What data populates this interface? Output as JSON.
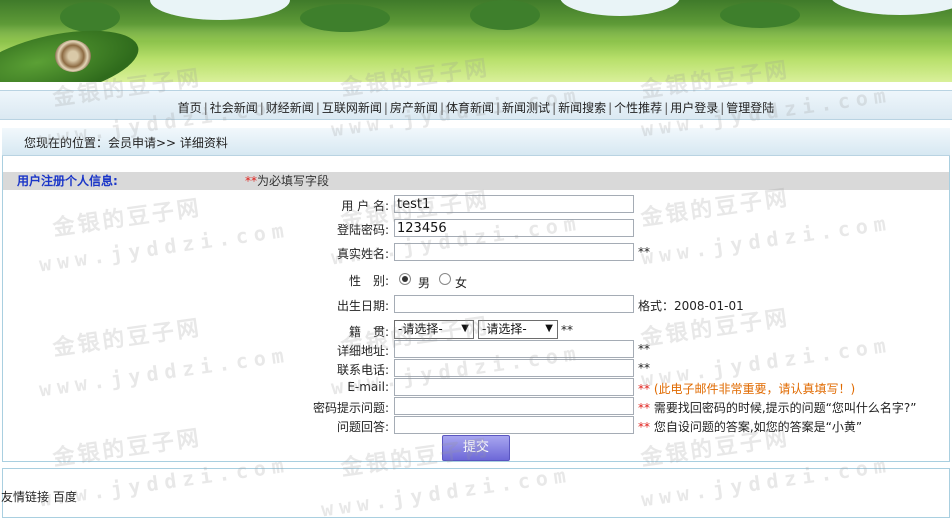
{
  "nav": {
    "items": [
      "首页",
      "社会新闻",
      "财经新闻",
      "互联网新闻",
      "房产新闻",
      "体育新闻",
      "新闻测试",
      "新闻搜索",
      "个性推荐",
      "用户登录",
      "管理登陆"
    ],
    "separator": "|"
  },
  "location": {
    "text": "您现在的位置：会员申请>> 详细资料"
  },
  "form_header": {
    "title": "用户注册个人信息:",
    "required_mark": "**",
    "required_text": "为必填写字段"
  },
  "fields": {
    "username": {
      "label": "用 户 名:",
      "value": "test1"
    },
    "password": {
      "label": "登陆密码:",
      "value": "123456"
    },
    "realname": {
      "label": "真实姓名:",
      "value": "",
      "mark": "**"
    },
    "gender": {
      "label": "性　别:",
      "options": [
        "男",
        "女"
      ],
      "selected": "男"
    },
    "birthday": {
      "label": "出生日期:",
      "value": "",
      "hint": "格式：2008-01-01"
    },
    "origin": {
      "label": "籍　贯:",
      "province": "-请选择-",
      "city": "-请选择-",
      "mark": "**"
    },
    "address": {
      "label": "详细地址:",
      "value": "",
      "mark": "**"
    },
    "phone": {
      "label": "联系电话:",
      "value": "",
      "mark": "**"
    },
    "email": {
      "label": "E-mail:",
      "value": "",
      "mark": "**",
      "hint": "(此电子邮件非常重要，请认真填写！)"
    },
    "question": {
      "label": "密码提示问题:",
      "value": "",
      "mark": "**",
      "hint": "需要找回密码的时候,提示的问题“您叫什么名字?”"
    },
    "answer": {
      "label": "问题回答:",
      "value": "",
      "mark": "**",
      "hint": "您自设问题的答案,如您的答案是“小黄”"
    }
  },
  "submit_label": "提交",
  "footer": {
    "links_label": "友情链接",
    "link": "百度"
  },
  "watermark": {
    "cn": "金银的豆子网",
    "en": "www.jyddzi.com"
  }
}
